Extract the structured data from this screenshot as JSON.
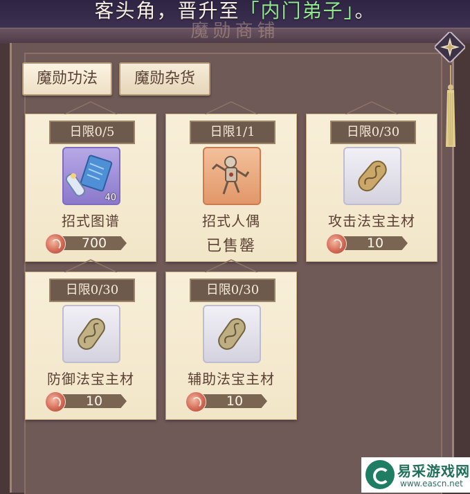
{
  "notice": {
    "prefix": "客头角，晋升至",
    "highlight": "「内门弟子」",
    "suffix": "。"
  },
  "shop_title": "魔勋商铺",
  "tabs": [
    {
      "label": "魔勋功法",
      "active": true
    },
    {
      "label": "魔勋杂货",
      "active": false
    }
  ],
  "items": [
    {
      "limit": "日限0/5",
      "name": "招式图谱",
      "qty": "40",
      "price": "700",
      "sold": ""
    },
    {
      "limit": "日限1/1",
      "name": "招式人偶",
      "qty": "",
      "price": "",
      "sold": "已售罄"
    },
    {
      "limit": "日限0/30",
      "name": "攻击法宝主材",
      "qty": "",
      "price": "10",
      "sold": ""
    },
    {
      "limit": "日限0/30",
      "name": "防御法宝主材",
      "qty": "",
      "price": "10",
      "sold": ""
    },
    {
      "limit": "日限0/30",
      "name": "辅助法宝主材",
      "qty": "",
      "price": "10",
      "sold": ""
    }
  ],
  "icons": {
    "currency": "mohun-coin-icon",
    "scroll": "scroll-icon",
    "puppet": "puppet-icon",
    "material": "material-stone-icon",
    "ornament": "star-ornament-icon",
    "tassel": "tassel-icon"
  },
  "watermark": {
    "name": "易采游戏网",
    "url": "www.eascn.net"
  },
  "colors": {
    "highlight": "#8fe68d",
    "card": "#f4e9cf",
    "price_bar": "#7a6553"
  }
}
